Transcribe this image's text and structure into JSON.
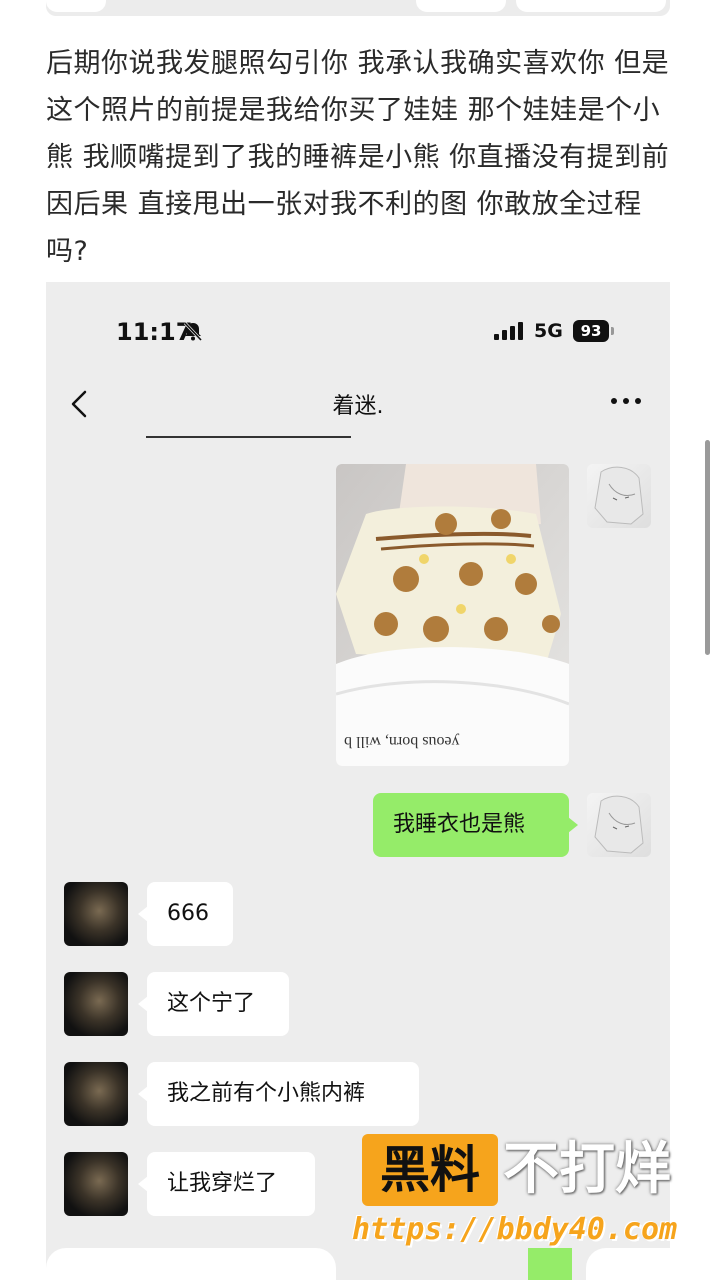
{
  "post": {
    "paragraph": "后期你说我发腿照勾引你 我承认我确实喜欢你 但是这个照片的前提是我给你买了娃娃 那个娃娃是个小熊 我顺嘴提到了我的睡裤是小熊 你直播没有提到前因后果 直接甩出一张对我不利的图 你敢放全过程吗?"
  },
  "screenshot": {
    "status_bar": {
      "time": "11:17",
      "network": "5G",
      "battery": "93"
    },
    "chat": {
      "title": "着迷.",
      "messages": [
        {
          "from": "me",
          "type": "image",
          "photo_caption": "yeous born, will b"
        },
        {
          "from": "me",
          "type": "text",
          "text": "我睡衣也是熊"
        },
        {
          "from": "other",
          "type": "text",
          "text": "666"
        },
        {
          "from": "other",
          "type": "text",
          "text": "这个宁了"
        },
        {
          "from": "other",
          "type": "text",
          "text": "我之前有个小熊内裤"
        },
        {
          "from": "other",
          "type": "text",
          "text": "让我穿烂了"
        }
      ]
    },
    "icons": [
      "bell-muted-icon",
      "signal-icon",
      "back-icon",
      "more-icon"
    ]
  },
  "watermark": {
    "badge": "黑料",
    "slogan": "不打烊",
    "url": "https://bbdy40.com"
  },
  "colors": {
    "my_bubble": "#95ec69",
    "other_bubble": "#ffffff",
    "chat_bg": "#ededed",
    "watermark": "#f6a41c"
  }
}
